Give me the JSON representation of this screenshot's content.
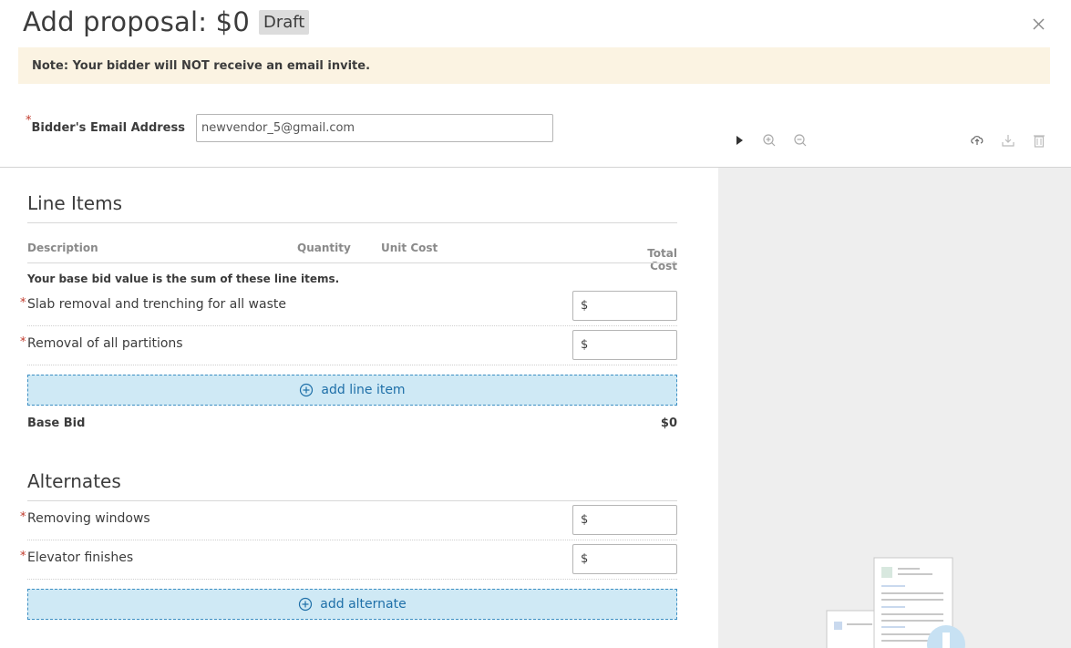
{
  "header": {
    "title": "Add proposal: $0",
    "badge": "Draft"
  },
  "note": {
    "text": "Note: Your bidder will NOT receive an email invite."
  },
  "email": {
    "label": "Bidder's Email Address",
    "value": "newvendor_5@gmail.com",
    "required_mark": "*"
  },
  "toolbar": {
    "icons": [
      "play-icon",
      "zoom-in-icon",
      "zoom-out-icon",
      "upload-icon",
      "download-icon",
      "trash-icon"
    ]
  },
  "line_items": {
    "title": "Line Items",
    "columns": {
      "description": "Description",
      "quantity": "Quantity",
      "unit_cost": "Unit Cost",
      "total_cost": "Total Cost"
    },
    "hint": "Your base bid value is the sum of these line items.",
    "items": [
      {
        "label": "Slab removal and trenching for all waste",
        "currency": "$"
      },
      {
        "label": "Removal of all partitions",
        "currency": "$"
      }
    ],
    "add_label": "add line item",
    "base_bid_label": "Base Bid",
    "base_bid_value": "$0"
  },
  "alternates": {
    "title": "Alternates",
    "items": [
      {
        "label": "Removing windows",
        "currency": "$"
      },
      {
        "label": "Elevator finishes",
        "currency": "$"
      }
    ],
    "add_label": "add alternate"
  },
  "colors": {
    "accent": "#1e6fa8",
    "required": "#c0392b",
    "note_bg": "#fbf3e2",
    "add_bg": "#cfe9f5"
  }
}
